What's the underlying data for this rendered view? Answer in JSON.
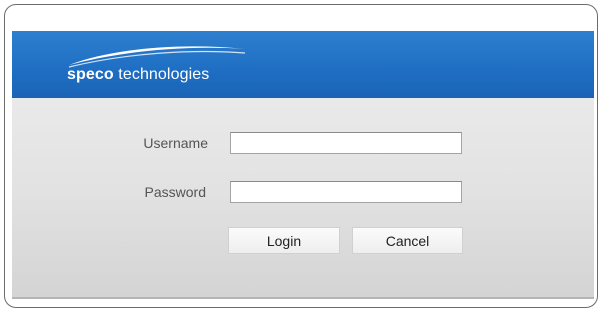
{
  "brand": {
    "logo_bold": "speco",
    "logo_rest": " technologies",
    "colors": {
      "banner": "#1f6fc4",
      "panel": "#e2e2e2",
      "label_text": "#555555"
    }
  },
  "login_form": {
    "username_label": "Username",
    "username_value": "",
    "password_label": "Password",
    "password_value": "",
    "login_label": "Login",
    "cancel_label": "Cancel"
  }
}
